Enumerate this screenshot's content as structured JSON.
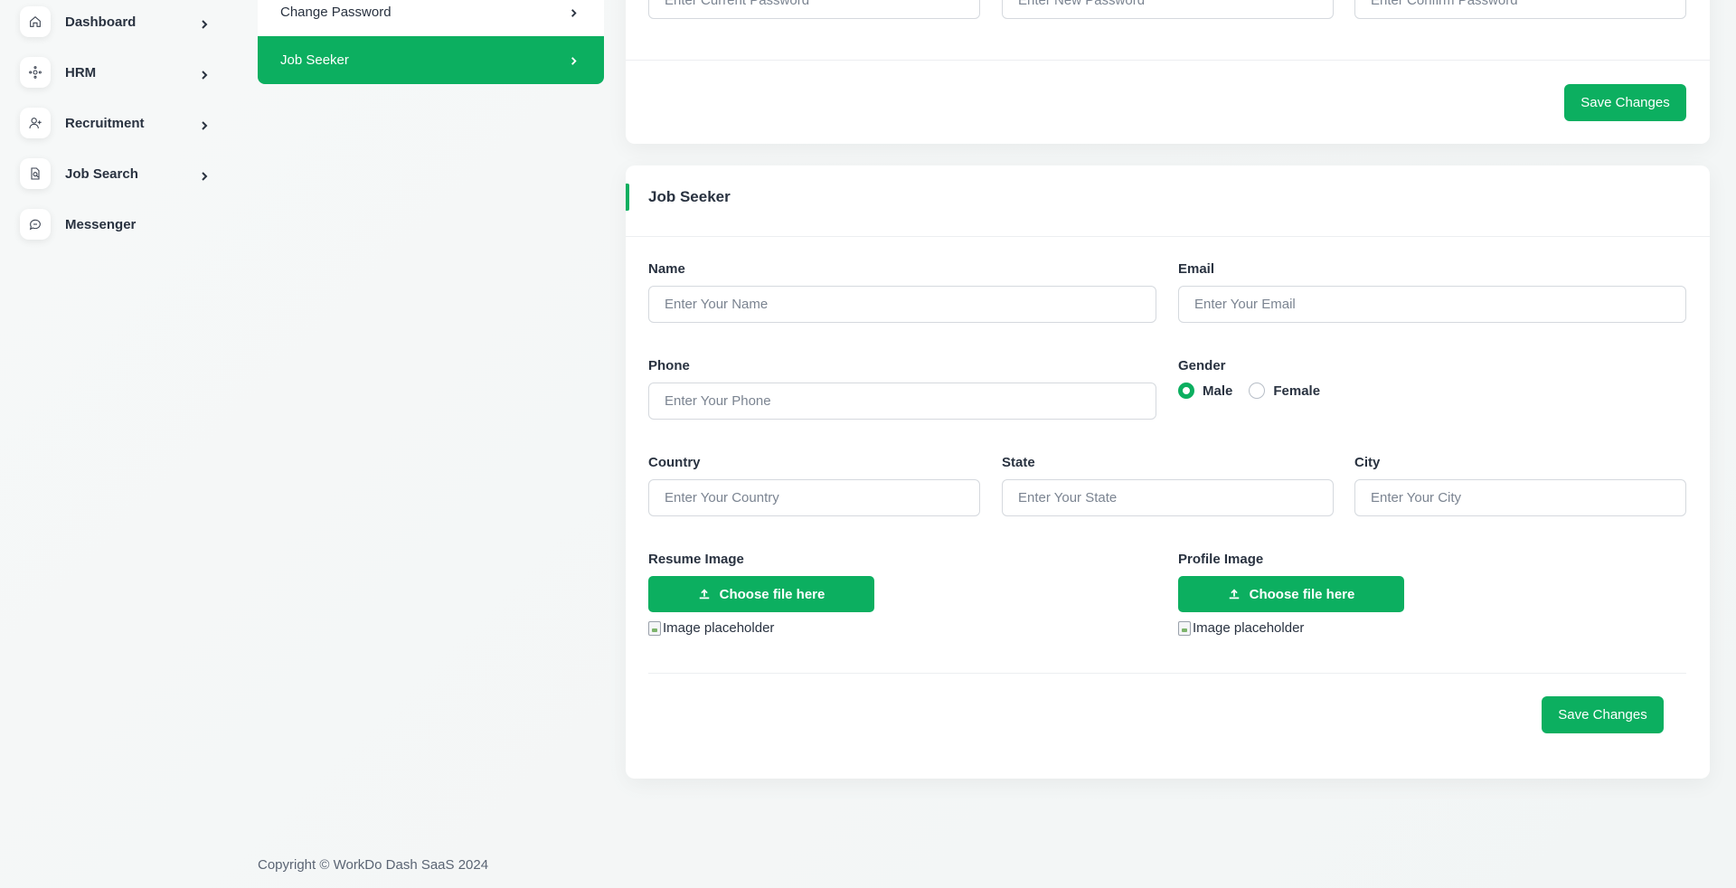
{
  "sidebar": {
    "items": [
      {
        "label": "Dashboard",
        "icon": "home-icon"
      },
      {
        "label": "HRM",
        "icon": "hrm-icon"
      },
      {
        "label": "Recruitment",
        "icon": "user-plus-icon"
      },
      {
        "label": "Job Search",
        "icon": "file-search-icon"
      },
      {
        "label": "Messenger",
        "icon": "chat-icon"
      }
    ]
  },
  "settings_menu": {
    "items": [
      {
        "label": "Change Password",
        "active": false
      },
      {
        "label": "Job Seeker",
        "active": true
      }
    ]
  },
  "password_card": {
    "current_placeholder": "Enter Current Password",
    "new_placeholder": "Enter New Password",
    "confirm_placeholder": "Enter Confirm Password",
    "save_label": "Save Changes"
  },
  "job_seeker_card": {
    "title": "Job Seeker",
    "name_label": "Name",
    "name_placeholder": "Enter Your Name",
    "email_label": "Email",
    "email_placeholder": "Enter Your Email",
    "phone_label": "Phone",
    "phone_placeholder": "Enter Your Phone",
    "gender_label": "Gender",
    "gender_options": [
      {
        "label": "Male",
        "checked": true
      },
      {
        "label": "Female",
        "checked": false
      }
    ],
    "country_label": "Country",
    "country_placeholder": "Enter Your Country",
    "state_label": "State",
    "state_placeholder": "Enter Your State",
    "city_label": "City",
    "city_placeholder": "Enter Your City",
    "resume_label": "Resume Image",
    "profile_label": "Profile Image",
    "choose_file_label": "Choose file here",
    "image_placeholder_alt": "Image placeholder",
    "save_label": "Save Changes"
  },
  "footer": {
    "copyright": "Copyright © WorkDo Dash SaaS 2024"
  },
  "colors": {
    "accent": "#0caf60",
    "text": "#293240",
    "border": "#d5d9de"
  }
}
